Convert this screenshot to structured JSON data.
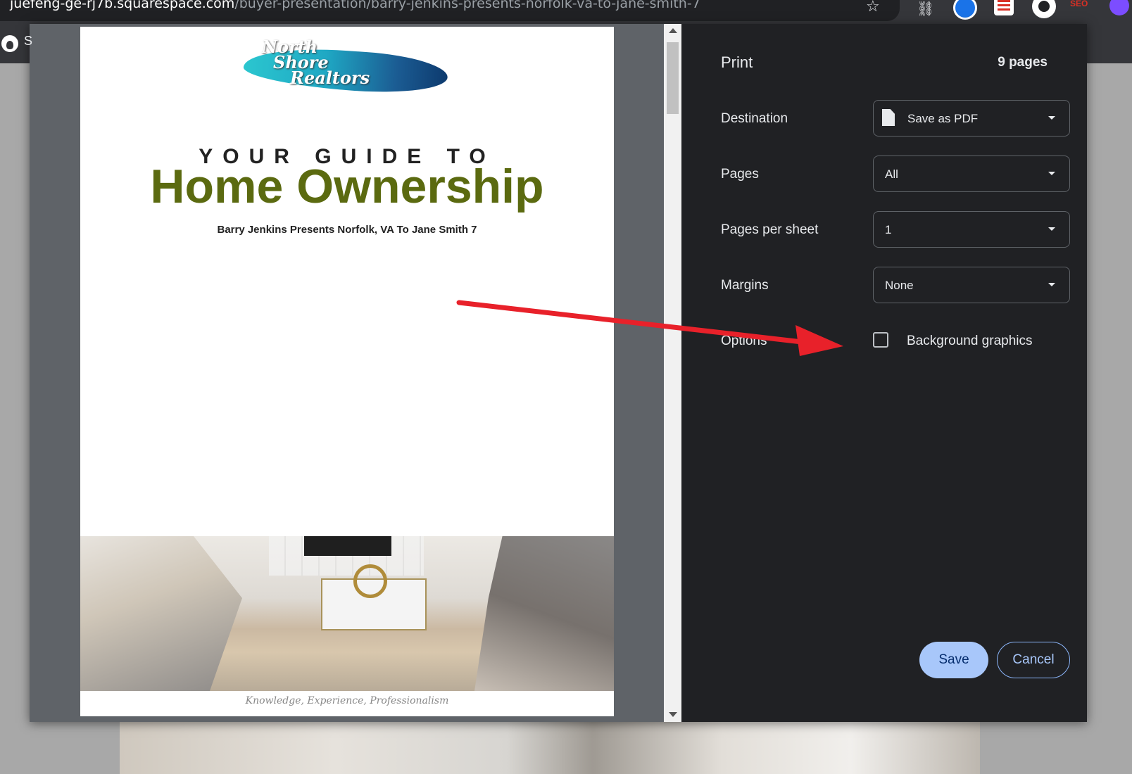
{
  "browser": {
    "url_host": "juefeng-ge-rj7b.squarespace.com",
    "url_path": "/buyer-presentation/barry-jenkins-presents-norfolk-va-to-jane-smith-7",
    "bookmark_letter": "S",
    "extension_badge": "SEO"
  },
  "preview": {
    "logo_lines": [
      "North",
      "Shore",
      "Realtors"
    ],
    "kicker": "YOUR GUIDE TO",
    "title": "Home Ownership",
    "subtitle": "Barry Jenkins Presents Norfolk, VA To Jane Smith 7",
    "footer": "Knowledge, Experience, Professionalism"
  },
  "print": {
    "title": "Print",
    "page_count": "9 pages",
    "destination": {
      "label": "Destination",
      "value": "Save as PDF"
    },
    "pages": {
      "label": "Pages",
      "value": "All"
    },
    "pages_per_sheet": {
      "label": "Pages per sheet",
      "value": "1"
    },
    "margins": {
      "label": "Margins",
      "value": "None"
    },
    "options": {
      "label": "Options",
      "background_graphics": "Background graphics",
      "background_graphics_checked": false
    },
    "save_label": "Save",
    "cancel_label": "Cancel"
  },
  "colors": {
    "annotation_arrow": "#e8212a",
    "title_green": "#5b6a10",
    "save_bg": "#a8c7fa"
  }
}
